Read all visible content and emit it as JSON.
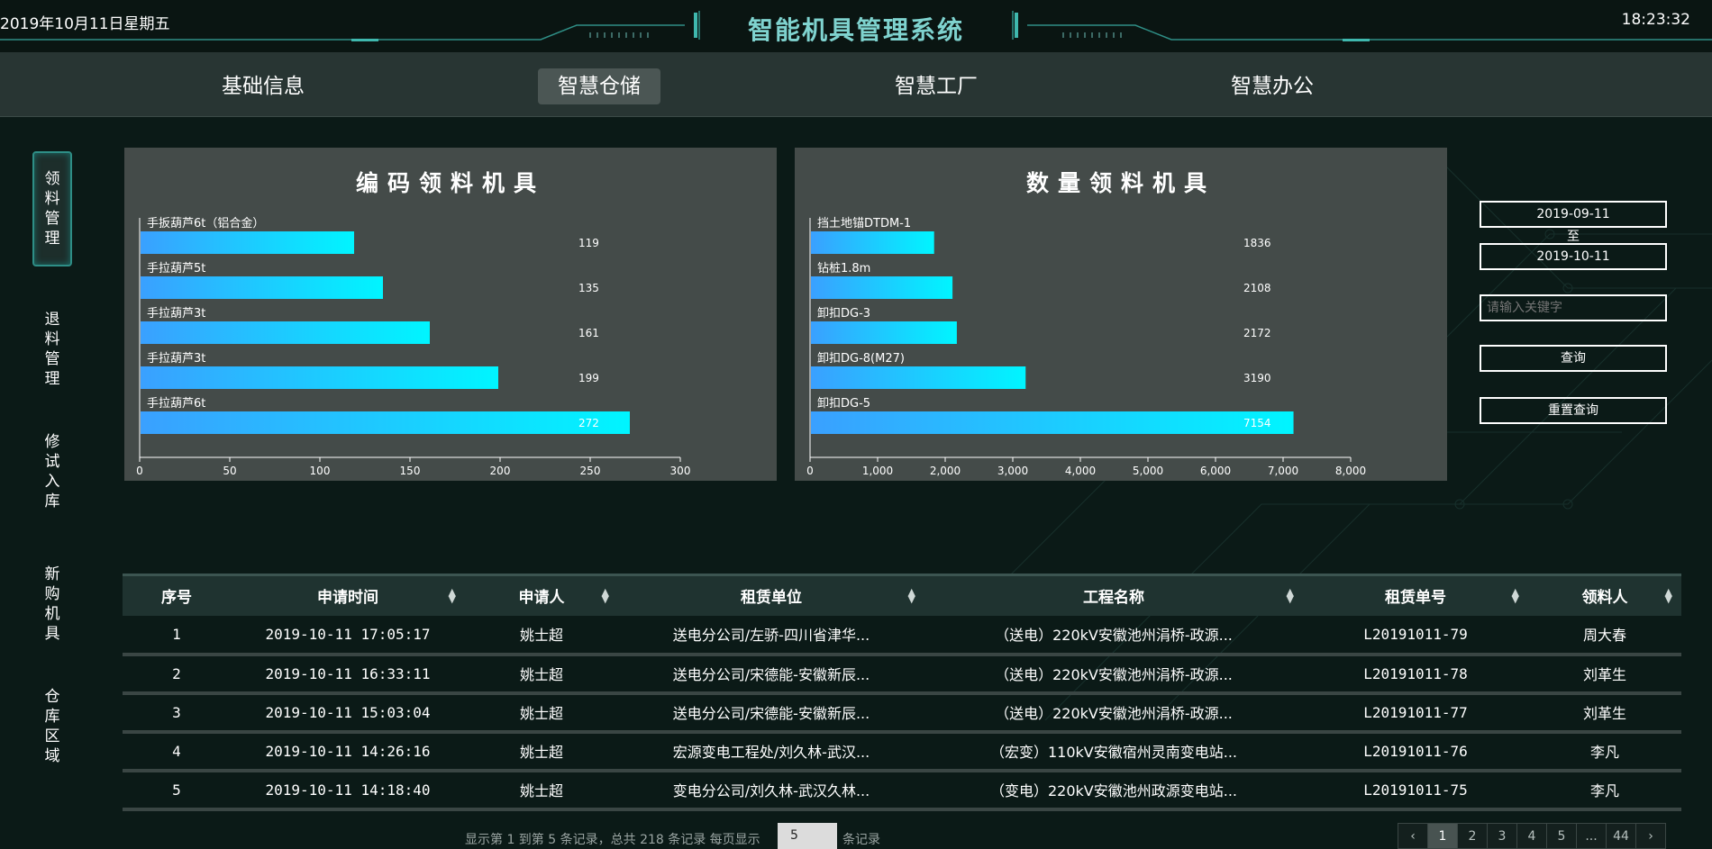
{
  "header": {
    "date": "2019年10月11日星期五",
    "title": "智能机具管理系统",
    "clock": "18:23:32"
  },
  "nav": {
    "items": [
      {
        "label": "基础信息"
      },
      {
        "label": "智慧仓储",
        "active": true
      },
      {
        "label": "智慧工厂"
      },
      {
        "label": "智慧办公"
      }
    ]
  },
  "sidebar": {
    "items": [
      {
        "label": "领料管理",
        "active": true
      },
      {
        "label": "退料管理"
      },
      {
        "label": "修试入库"
      },
      {
        "label": "新购机具"
      },
      {
        "label": "仓库区域"
      }
    ]
  },
  "filters": {
    "start_date": "2019-09-11",
    "separator": "至",
    "end_date": "2019-10-11",
    "keyword_placeholder": "请输入关键字",
    "query_label": "查询",
    "reset_label": "重置查询"
  },
  "chart_data": [
    {
      "type": "bar",
      "orientation": "horizontal",
      "title": "编码领料机具",
      "categories": [
        "手扳葫芦6t（铝合金）",
        "手拉葫芦5t",
        "手拉葫芦3t",
        "手拉葫芦3t",
        "手拉葫芦6t"
      ],
      "values": [
        119,
        135,
        161,
        199,
        272
      ],
      "xlim": [
        0,
        300
      ],
      "xticks": [
        0,
        50,
        100,
        150,
        200,
        250,
        300
      ],
      "grid": false,
      "colors": [
        "#3aa0ff",
        "#00f5ff"
      ]
    },
    {
      "type": "bar",
      "orientation": "horizontal",
      "title": "数量领料机具",
      "categories": [
        "挡土地锚DTDM-1",
        "钻桩1.8m",
        "卸扣DG-3",
        "卸扣DG-8(M27)",
        "卸扣DG-5"
      ],
      "values": [
        1836,
        2108,
        2172,
        3190,
        7154
      ],
      "xlim": [
        0,
        8000
      ],
      "xticks": [
        0,
        1000,
        2000,
        3000,
        4000,
        5000,
        6000,
        7000,
        8000
      ],
      "xtick_labels": [
        "0",
        "1,000",
        "2,000",
        "3,000",
        "4,000",
        "5,000",
        "6,000",
        "7,000",
        "8,000"
      ],
      "grid": false,
      "colors": [
        "#3aa0ff",
        "#00f5ff"
      ]
    }
  ],
  "table": {
    "columns": [
      "序号",
      "申请时间",
      "申请人",
      "租赁单位",
      "工程名称",
      "租赁单号",
      "领料人"
    ],
    "rows": [
      [
        "1",
        "2019-10-11 17:05:17",
        "姚士超",
        "送电分公司/左骄-四川省津华...",
        "（送电）220kV安徽池州涓桥-政源...",
        "L20191011-79",
        "周大春"
      ],
      [
        "2",
        "2019-10-11 16:33:11",
        "姚士超",
        "送电分公司/宋德能-安徽新辰...",
        "（送电）220kV安徽池州涓桥-政源...",
        "L20191011-78",
        "刘革生"
      ],
      [
        "3",
        "2019-10-11 15:03:04",
        "姚士超",
        "送电分公司/宋德能-安徽新辰...",
        "（送电）220kV安徽池州涓桥-政源...",
        "L20191011-77",
        "刘革生"
      ],
      [
        "4",
        "2019-10-11 14:26:16",
        "姚士超",
        "宏源变电工程处/刘久林-武汉...",
        "（宏变）110kV安徽宿州灵南变电站...",
        "L20191011-76",
        "李凡"
      ],
      [
        "5",
        "2019-10-11 14:18:40",
        "姚士超",
        "变电分公司/刘久林-武汉久林...",
        "（变电）220kV安徽池州政源变电站...",
        "L20191011-75",
        "李凡"
      ]
    ]
  },
  "pagination": {
    "info": "显示第 1 到第 5 条记录，总共 218 条记录 每页显示",
    "page_size": "5",
    "tail": "条记录",
    "prev": "‹",
    "pages": [
      "1",
      "2",
      "3",
      "4",
      "5",
      "...",
      "44"
    ],
    "next": "›",
    "current": "1"
  }
}
